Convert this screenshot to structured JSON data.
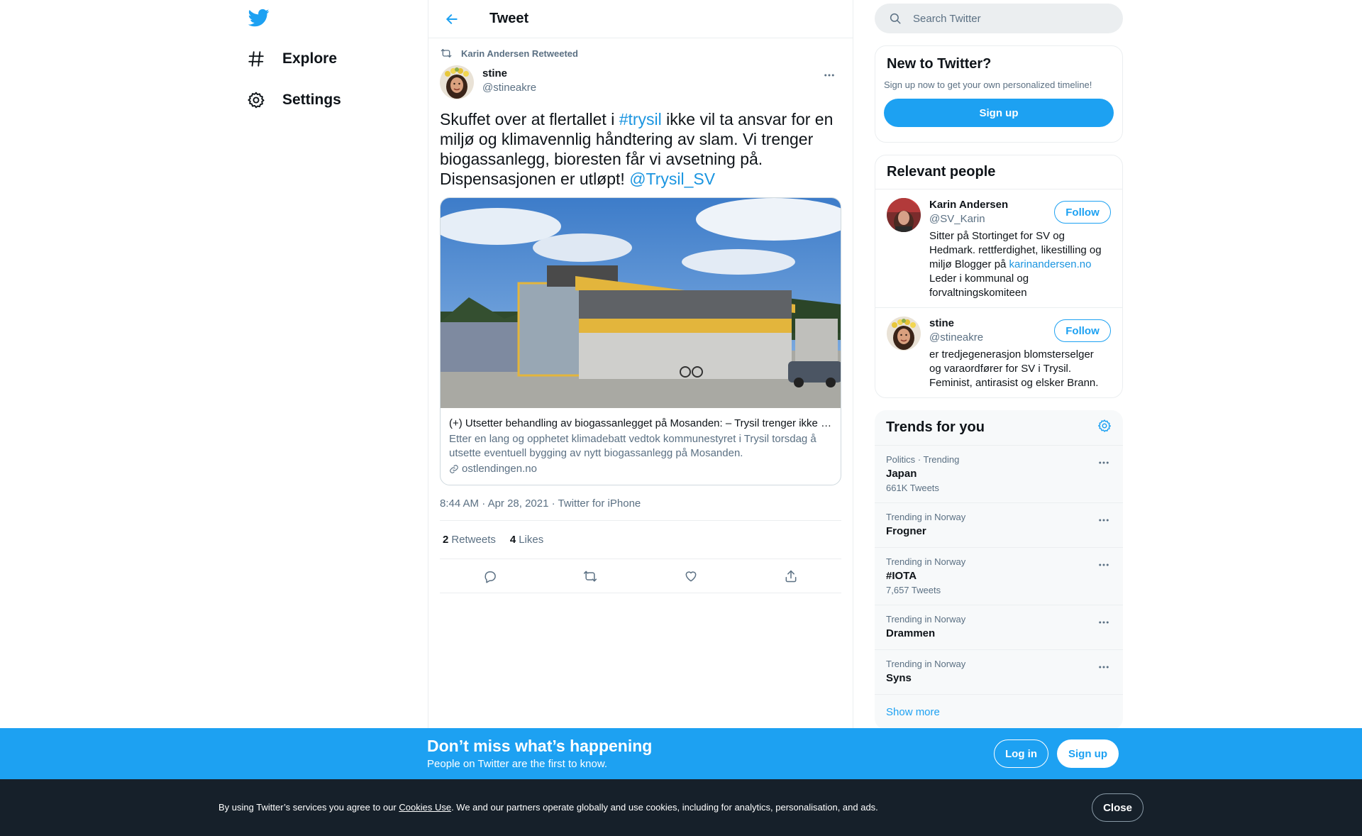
{
  "nav": {
    "items": [
      {
        "label": "Explore",
        "icon": "hashtag-icon"
      },
      {
        "label": "Settings",
        "icon": "gear-icon"
      }
    ]
  },
  "header": {
    "title": "Tweet"
  },
  "tweet": {
    "retweeted_by": "Karin Andersen Retweeted",
    "author_name": "stine",
    "author_handle": "@stineakre",
    "text_1": "Skuffet over at flertallet i ",
    "hashtag": "#trysil",
    "text_2": " ikke vil ta ansvar for en miljø og klimavennlig håndtering av slam. Vi trenger biogassanlegg, bioresten får vi avsetning på. Dispensasjonen er utløpt! ",
    "mention": "@Trysil_SV",
    "card": {
      "title": "(+) Utsetter behandling av biogassanlegget på Mosanden: – Trysil trenger ikke et millionanlegg",
      "description": "Etter en lang og opphetet klimadebatt vedtok kommunestyret i Trysil torsdag å utsette eventuell bygging av nytt biogassanlegg på Mosanden.",
      "domain": "ostlendingen.no"
    },
    "time": "8:44 AM",
    "date": "Apr 28, 2021",
    "source": "Twitter for iPhone",
    "retweets": "2",
    "retweets_label": "Retweets",
    "likes": "4",
    "likes_label": "Likes"
  },
  "search": {
    "placeholder": "Search Twitter"
  },
  "new_to_twitter": {
    "title": "New to Twitter?",
    "subtitle": "Sign up now to get your own personalized timeline!",
    "button": "Sign up"
  },
  "relevant": {
    "title": "Relevant people",
    "people": [
      {
        "name": "Karin Andersen",
        "handle": "@SV_Karin",
        "bio_1": "Sitter på Stortinget for SV og Hedmark. rettferdighet, likestilling og miljø Blogger på ",
        "bio_link": "karinandersen.no",
        "bio_2": " Leder i kommunal og forvaltningskomiteen",
        "button": "Follow"
      },
      {
        "name": "stine",
        "handle": "@stineakre",
        "bio_1": "er tredjegenerasjon blomsterselger og varaordfører for SV i Trysil. Feminist, antirasist og elsker Brann.",
        "button": "Follow"
      }
    ]
  },
  "trends": {
    "title": "Trends for you",
    "items": [
      {
        "context": "Politics · Trending",
        "name": "Japan",
        "count": "661K Tweets"
      },
      {
        "context": "Trending in Norway",
        "name": "Frogner",
        "count": ""
      },
      {
        "context": "Trending in Norway",
        "name": "#IOTA",
        "count": "7,657 Tweets"
      },
      {
        "context": "Trending in Norway",
        "name": "Drammen",
        "count": ""
      },
      {
        "context": "Trending in Norway",
        "name": "Syns",
        "count": ""
      }
    ],
    "show_more": "Show more"
  },
  "signup_bar": {
    "title": "Don’t miss what’s happening",
    "subtitle": "People on Twitter are the first to know.",
    "login": "Log in",
    "signup": "Sign up"
  },
  "cookie": {
    "text_1": "By using Twitter’s services you agree to our ",
    "link": "Cookies Use",
    "text_2": ". We and our partners operate globally and use cookies, including for analytics, personalisation, and ads.",
    "close": "Close"
  },
  "colors": {
    "accent": "#1da1f2",
    "link": "#1b95e0",
    "secondary_text": "#5b7083",
    "cookie_bg": "#16202a"
  }
}
